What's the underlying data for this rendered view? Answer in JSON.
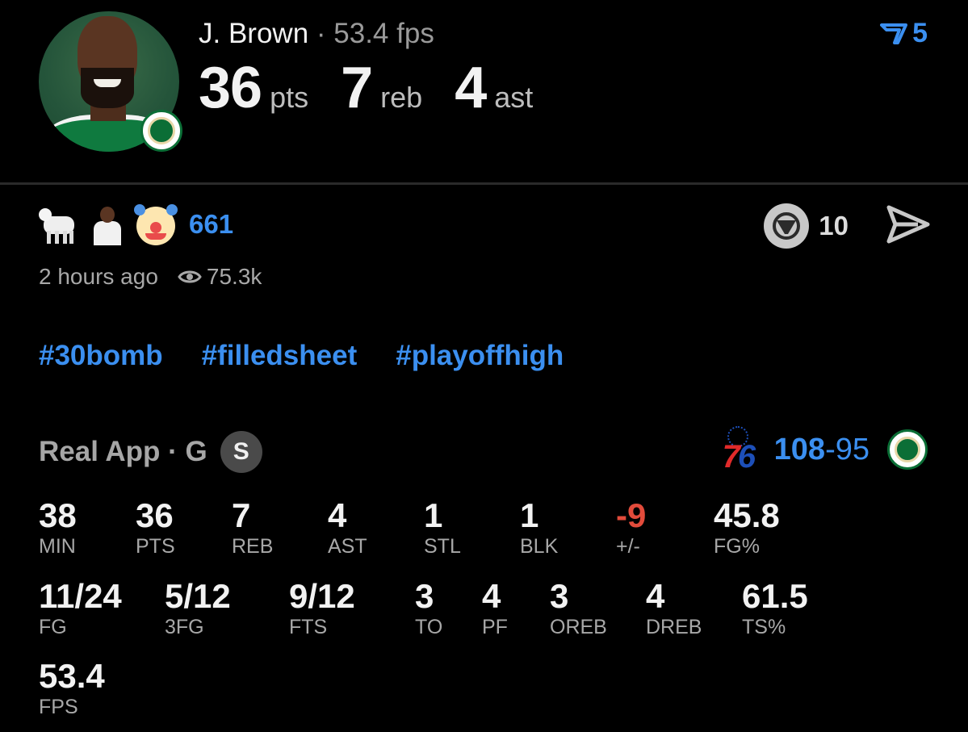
{
  "header": {
    "player_name": "J. Brown",
    "separator": "·",
    "fps_text": "53.4 fps",
    "filter_count": "5",
    "big_stats": [
      {
        "value": "36",
        "unit": "pts"
      },
      {
        "value": "7",
        "unit": "reb"
      },
      {
        "value": "4",
        "unit": "ast"
      }
    ],
    "avatar_icon": "player-headshot",
    "team_badge_icon": "celtics-logo"
  },
  "post": {
    "reaction_icons": [
      "goat-emoji",
      "player-emoji",
      "clown-emoji"
    ],
    "reaction_count": "661",
    "vote_count": "10",
    "time_ago": "2 hours ago",
    "views": "75.3k",
    "hashtags": [
      "#30bomb",
      "#filledsheet",
      "#playoffhigh"
    ]
  },
  "source": {
    "label": "Real App · G",
    "badge": "S"
  },
  "score": {
    "team_a_score": "108",
    "dash": "-",
    "team_b_score": "95",
    "logo_a_text": "76",
    "team_a_icon": "76ers-logo",
    "team_b_icon": "celtics-logo"
  },
  "stats": {
    "row1": [
      {
        "value": "38",
        "label": "MIN"
      },
      {
        "value": "36",
        "label": "PTS"
      },
      {
        "value": "7",
        "label": "REB"
      },
      {
        "value": "4",
        "label": "AST"
      },
      {
        "value": "1",
        "label": "STL"
      },
      {
        "value": "1",
        "label": "BLK"
      },
      {
        "value": "-9",
        "label": "+/-"
      },
      {
        "value": "45.8",
        "label": "FG%"
      }
    ],
    "row2": [
      {
        "value": "11/24",
        "label": "FG"
      },
      {
        "value": "5/12",
        "label": "3FG"
      },
      {
        "value": "9/12",
        "label": "FTS"
      },
      {
        "value": "3",
        "label": "TO"
      },
      {
        "value": "4",
        "label": "PF"
      },
      {
        "value": "3",
        "label": "OREB"
      },
      {
        "value": "4",
        "label": "DREB"
      },
      {
        "value": "61.5",
        "label": "TS%"
      }
    ],
    "row3": [
      {
        "value": "53.4",
        "label": "FPS"
      }
    ]
  },
  "colors": {
    "accent": "#3b8ff0",
    "negative": "#e24b3b",
    "background": "#000000",
    "muted": "#a8a8a8"
  }
}
